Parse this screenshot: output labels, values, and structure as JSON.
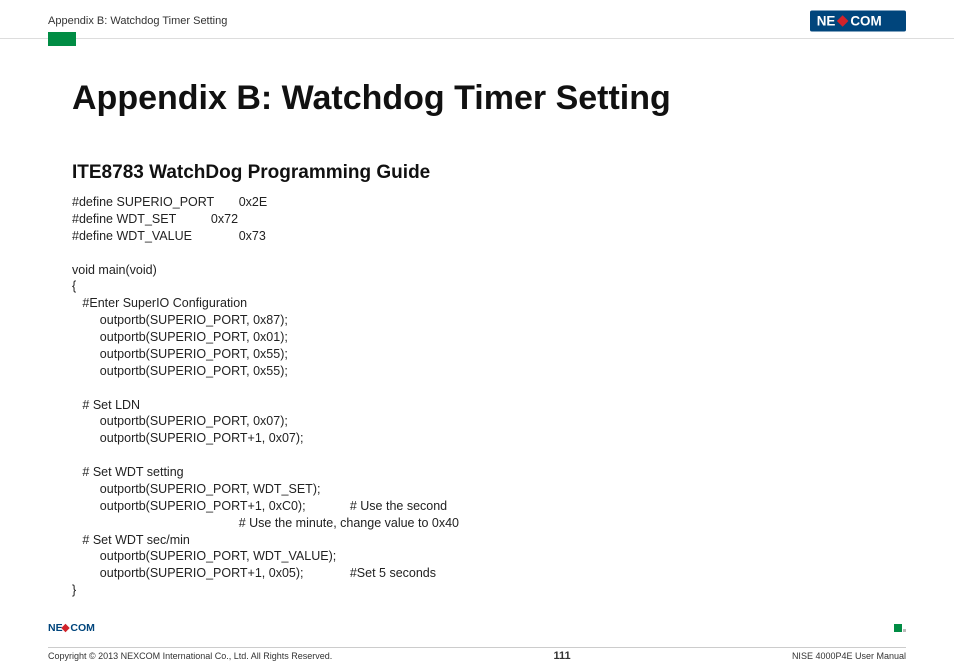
{
  "header": {
    "title": "Appendix B: Watchdog Timer Setting",
    "logo_text": "NEXCOM"
  },
  "content": {
    "page_title": "Appendix B: Watchdog Timer Setting",
    "section_title": "ITE8783 WatchDog Programming Guide",
    "code": "#define SUPERIO_PORT\t0x2E\n#define WDT_SET\t\t0x72\n#define WDT_VALUE\t\t0x73\n\nvoid main(void)\n{\n   #Enter SuperIO Configuration\n\toutportb(SUPERIO_PORT, 0x87);\n\toutportb(SUPERIO_PORT, 0x01);\n\toutportb(SUPERIO_PORT, 0x55);\n\toutportb(SUPERIO_PORT, 0x55);\n\n   # Set LDN\n\toutportb(SUPERIO_PORT, 0x07);\n\toutportb(SUPERIO_PORT+1, 0x07);\n\n   # Set WDT setting\n\toutportb(SUPERIO_PORT, WDT_SET);\n\toutportb(SUPERIO_PORT+1, 0xC0);\t\t# Use the second\n\t\t\t\t\t\t# Use the minute, change value to 0x40\n   # Set WDT sec/min\n\toutportb(SUPERIO_PORT, WDT_VALUE);\n\toutportb(SUPERIO_PORT+1, 0x05);\t\t#Set 5 seconds\n}"
  },
  "footer": {
    "copyright": "Copyright © 2013 NEXCOM International Co., Ltd. All Rights Reserved.",
    "page_number": "111",
    "manual_ref": "NISE 4000P4E User Manual",
    "logo_text": "NEXCOM"
  }
}
